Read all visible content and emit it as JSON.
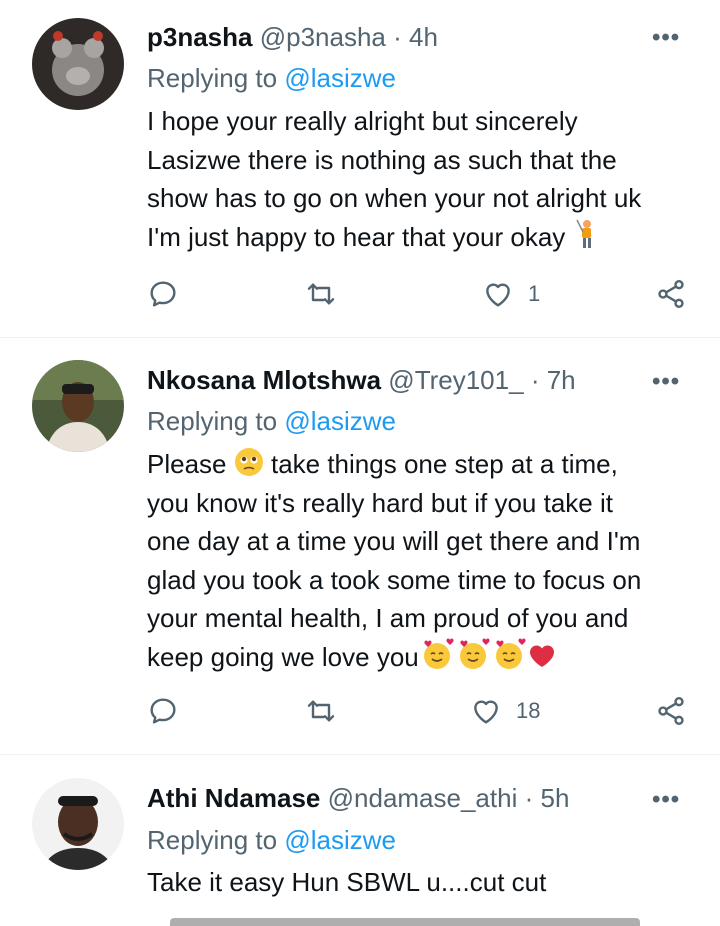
{
  "tweets": [
    {
      "name": "p3nasha",
      "handle": "@p3nasha",
      "sep": "·",
      "time": "4h",
      "replying_prefix": "Replying to",
      "replying_to": "@lasizwe",
      "lines": [
        "I hope your really alright but sincerely",
        "Lasizwe  there is nothing as such that the",
        "show has to go on when your not alright uk",
        "I'm just happy to hear that your okay"
      ],
      "like_count": "1"
    },
    {
      "name": "Nkosana Mlotshwa",
      "handle": "@Trey101_",
      "sep": "·",
      "time": "7h",
      "replying_prefix": "Replying to",
      "replying_to": "@lasizwe",
      "lines": [
        "Please",
        "take things one step at a time,",
        "you know it's really hard but if you take it",
        "one day at a time you will get there and I'm",
        "glad you took a took some time to focus on",
        "your mental health, I am proud of you and",
        "keep going we love you"
      ],
      "like_count": "18"
    },
    {
      "name": "Athi Ndamase",
      "handle": "@ndamase_athi",
      "sep": "·",
      "time": "5h",
      "replying_prefix": "Replying to",
      "replying_to": "@lasizwe",
      "lines": [
        "Take it easy Hun SBWL u....cut cut"
      ]
    }
  ],
  "icons": {
    "reply": "reply-icon",
    "retweet": "retweet-icon",
    "like": "heart-icon",
    "share": "share-icon",
    "more": "more-icon"
  },
  "colors": {
    "link": "#1d9bf0",
    "secondary": "#536471",
    "text": "#0f1419",
    "divider": "#eff3f4"
  }
}
